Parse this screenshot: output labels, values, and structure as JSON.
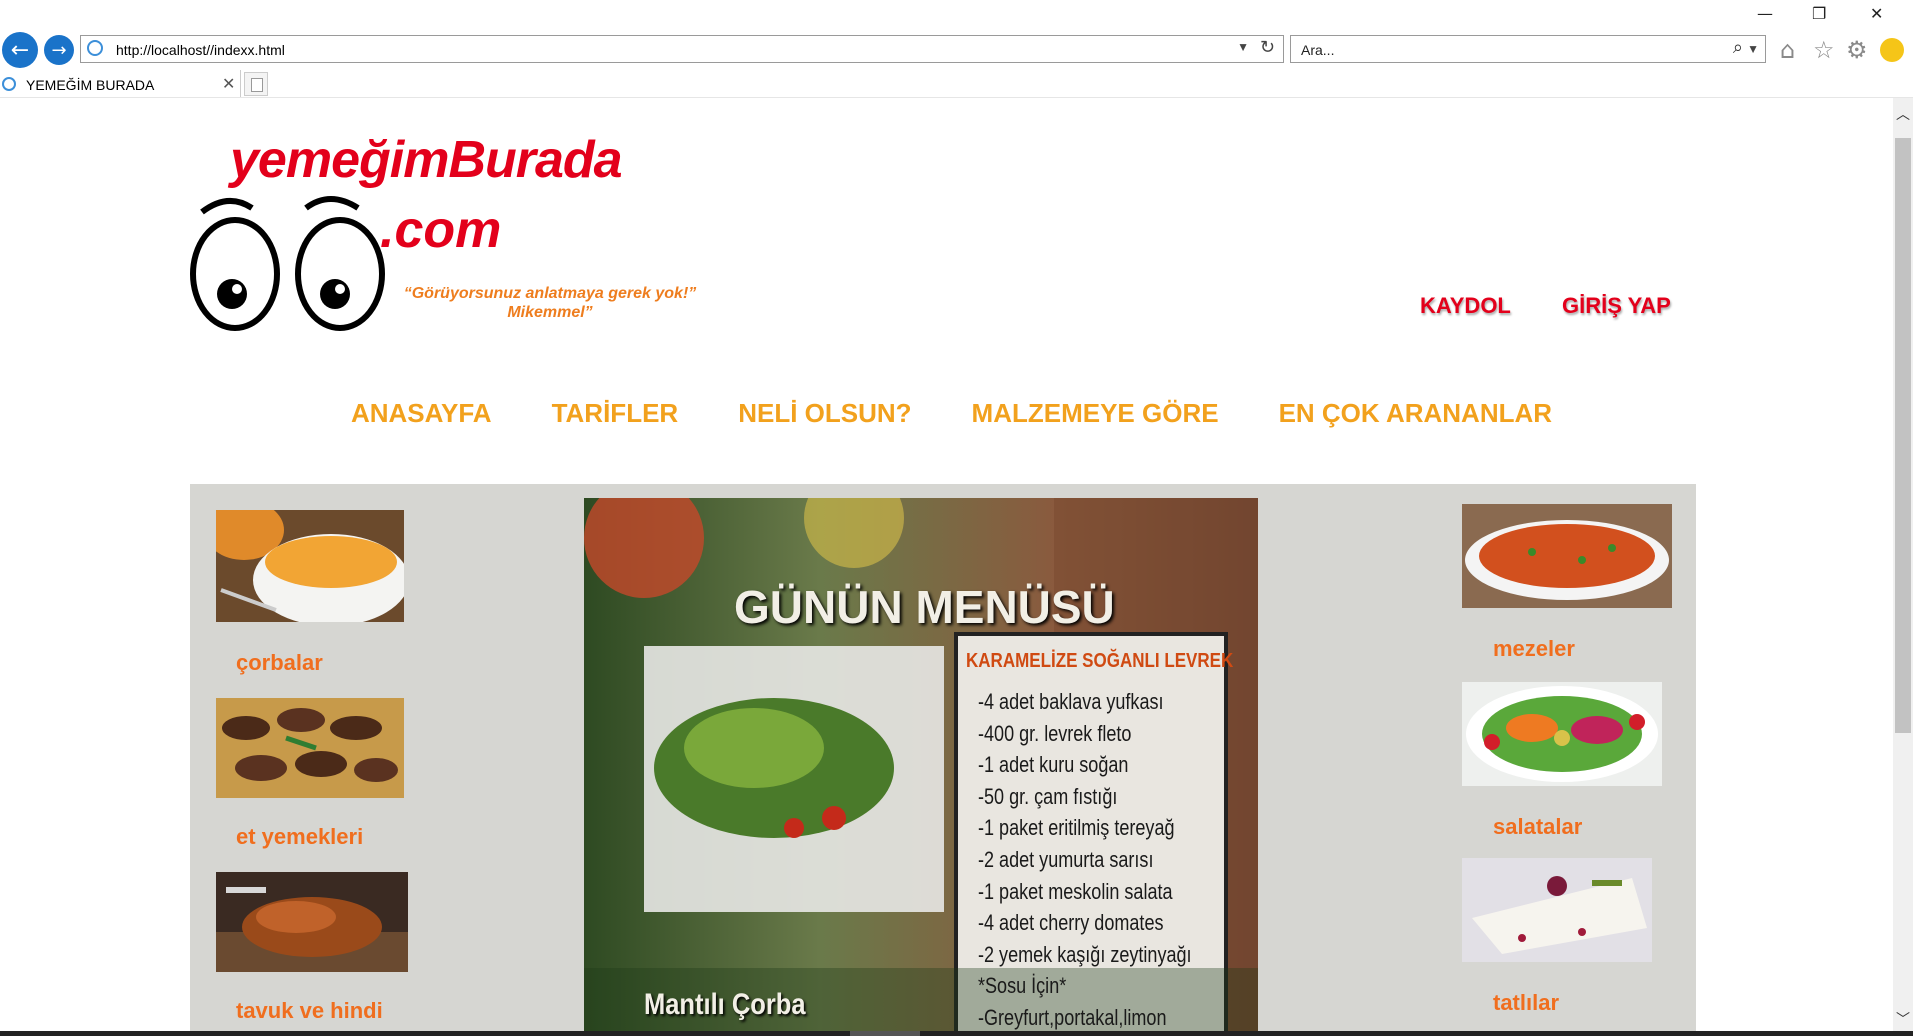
{
  "browser": {
    "url": "http://localhost//indexx.html",
    "search_placeholder": "Ara...",
    "tab_title": "YEMEĞİM BURADA",
    "minimize_label": "—",
    "restore_label": "❐",
    "close_label": "✕",
    "tab_close_label": "✕"
  },
  "header": {
    "brand_name": "yemeğimBurada",
    "brand_domain": ".com",
    "tagline": "“Görüyorsunuz anlatmaya gerek yok!” Mikemmel”",
    "register": "KAYDOL",
    "login": "GİRİŞ YAP"
  },
  "nav": [
    "ANASAYFA",
    "TARİFLER",
    "NELİ OLSUN?",
    "MALZEMEYE GÖRE",
    "EN ÇOK ARANANLAR"
  ],
  "left_categories": [
    "çorbalar",
    "et yemekleri",
    "tavuk ve hindi"
  ],
  "right_categories": [
    "mezeler",
    "salatalar",
    "tatlılar"
  ],
  "daily_menu": {
    "title": "GÜNÜN MENÜSÜ",
    "recipe_title": "KARAMELİZE SOĞANLI LEVREK",
    "ingredients": [
      "-4 adet baklava yufkası",
      "-400 gr. levrek fleto",
      "-1 adet kuru soğan",
      "-50 gr. çam fıstığı",
      "-1 paket eritilmiş tereyağ",
      "-2 adet yumurta sarısı",
      "-1 paket meskolin salata",
      "-4 adet cherry domates",
      "-2 yemek kaşığı zeytinyağı",
      "*Sosu İçin*",
      "-Greyfurt,portakal,limon"
    ],
    "bottom_label": "Mantılı Çorba"
  },
  "colors": {
    "brand_red": "#e3001b",
    "nav_orange": "#f2a11d",
    "category_orange": "#f06e1e",
    "content_bg": "#d6d6d2"
  }
}
